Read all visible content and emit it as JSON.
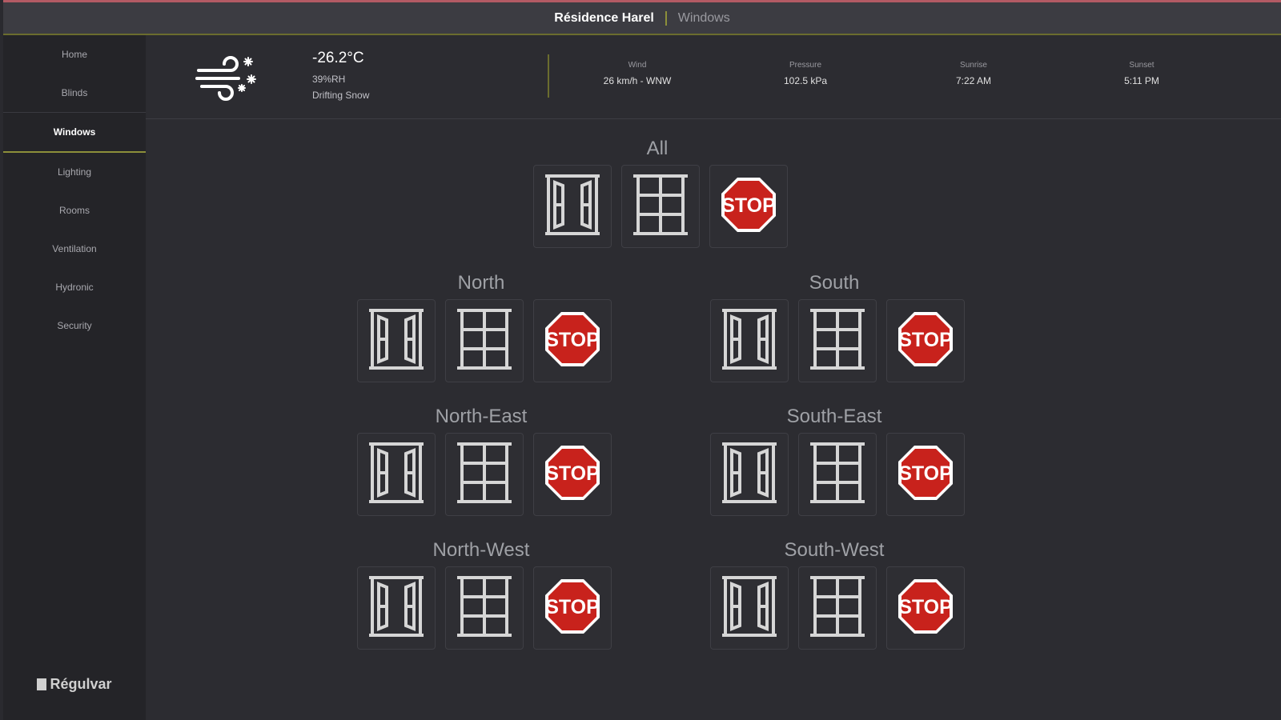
{
  "app": {
    "brand": "Résidence Harel",
    "current_page": "Windows"
  },
  "sidebar": {
    "items": [
      {
        "label": "Home"
      },
      {
        "label": "Blinds"
      },
      {
        "label": "Windows",
        "active": true
      },
      {
        "label": "Lighting"
      },
      {
        "label": "Rooms"
      },
      {
        "label": "Ventilation"
      },
      {
        "label": "Hydronic"
      },
      {
        "label": "Security"
      }
    ],
    "logo_text": "Régulvar"
  },
  "weather": {
    "icon": "drifting-snow-icon",
    "temperature": "-26.2°C",
    "humidity": "39%RH",
    "condition": "Drifting Snow",
    "stats": [
      {
        "label": "Wind",
        "value": "26 km/h - WNW"
      },
      {
        "label": "Pressure",
        "value": "102.5 kPa"
      },
      {
        "label": "Sunrise",
        "value": "7:22 AM"
      },
      {
        "label": "Sunset",
        "value": "5:11 PM"
      }
    ]
  },
  "window_groups": [
    {
      "name": "All"
    },
    {
      "name": "North"
    },
    {
      "name": "South"
    },
    {
      "name": "North-East"
    },
    {
      "name": "South-East"
    },
    {
      "name": "North-West"
    },
    {
      "name": "South-West"
    }
  ],
  "actions": {
    "open": {
      "icon": "window-open-icon"
    },
    "close": {
      "icon": "window-closed-icon"
    },
    "stop": {
      "icon": "stop-sign-icon",
      "label": "STOP"
    }
  },
  "colors": {
    "accent": "#8c8f3a",
    "stop_red": "#c8221c",
    "background": "#2c2c31"
  }
}
